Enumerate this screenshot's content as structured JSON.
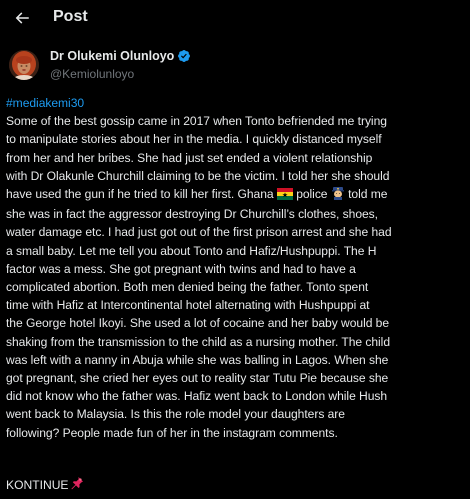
{
  "header": {
    "title": "Post",
    "back_icon": "arrow-left-icon"
  },
  "author": {
    "display_name": "Dr Olukemi Olunloyo",
    "handle": "@Kemiolunloyo",
    "verified_icon": "verified-badge-icon",
    "verified_color": "#1d9bf0"
  },
  "tweet": {
    "hashtag": "#mediakemi30",
    "lines": [
      "Some of the best gossip came in 2017 when Tonto befriended me trying",
      "to manipulate stories about her in the media. I quickly distanced myself",
      "from her and her bribes. She had just set ended a violent relationship",
      "with Dr Olakunle Churchill claiming to be the victim. I told her she should",
      "have used the gun if he tried to kill her first. Ghana",
      "police",
      "told me",
      "she was in fact the aggressor destroying Dr Churchill’s clothes, shoes,",
      "water damage etc. I had just got out of the first prison arrest and she had",
      "a small baby. Let me tell you about Tonto and Hafiz/Hushpuppi. The H",
      "factor was a mess. She got pregnant with twins and had to have a",
      "complicated abortion. Both men denied being the father. Tonto spent",
      "time with Hafiz at Intercontinental hotel alternating with Hushpuppi at",
      "the George hotel Ikoyi. She used a lot of cocaine and her baby would be",
      "shaking from the transmission to the child as a nursing mother. The child",
      "was left with a nanny in Abuja while she was balling in Lagos. When she",
      "got pregnant, she cried her eyes out to reality star Tutu Pie because she",
      "did not know who the father was. Hafiz went back to London while Hush",
      "went back to Malaysia. Is this the role model your daughters are",
      "following? People made fun of her in the instagram comments."
    ],
    "footer": "KONTINUE",
    "footer_icon": "pushpin-icon"
  },
  "colors": {
    "background": "#000000",
    "text": "#e7e9ea",
    "secondary_text": "#71767b",
    "link": "#1d9bf0"
  }
}
